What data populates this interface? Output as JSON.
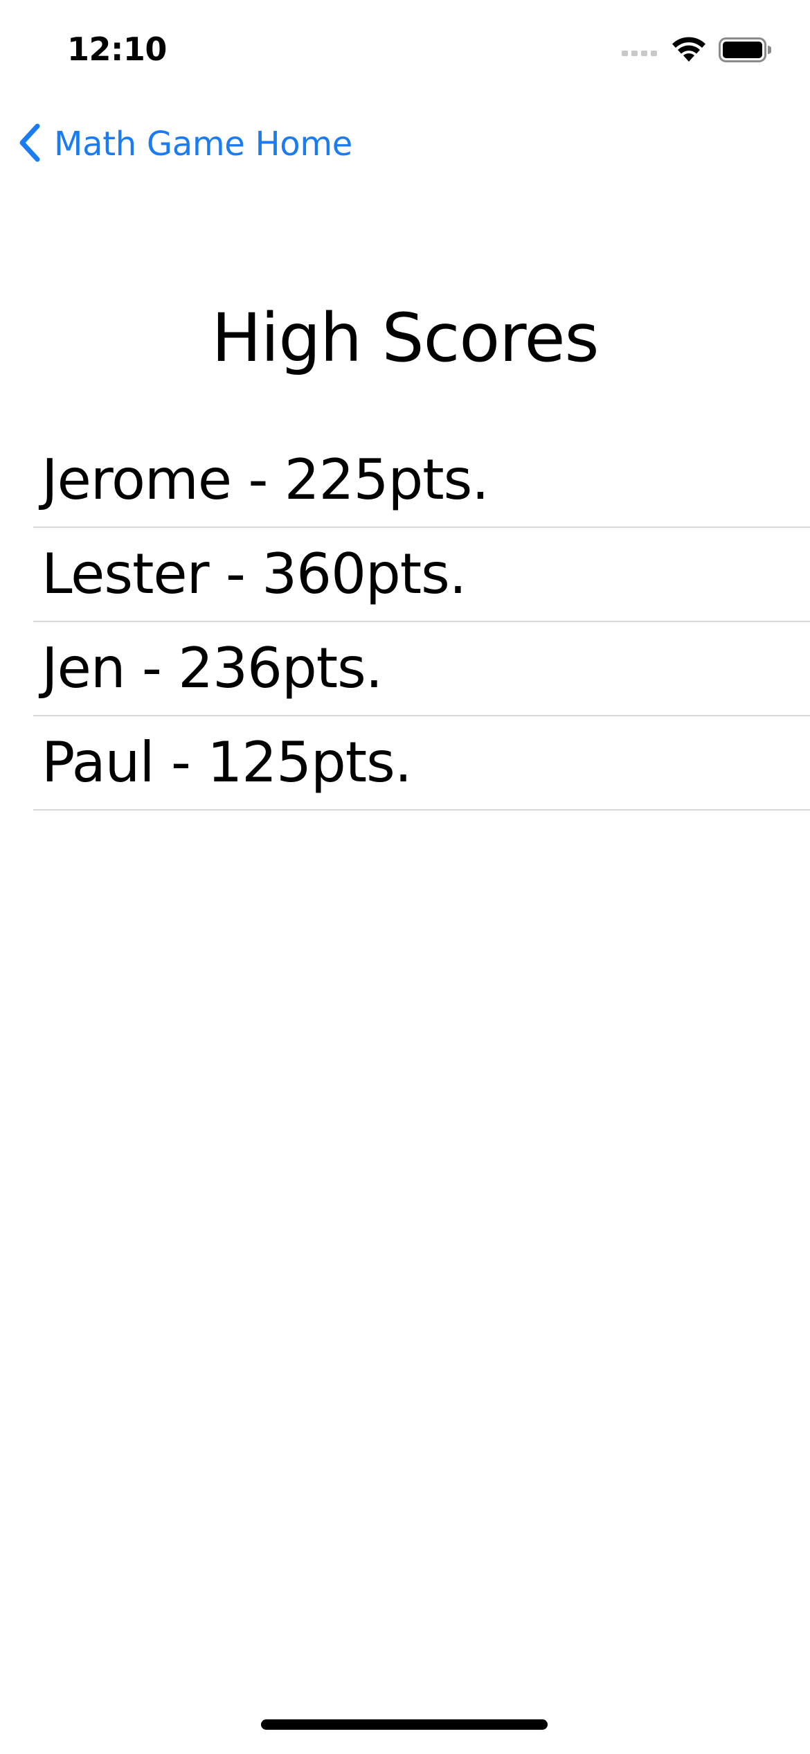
{
  "status_bar": {
    "time": "12:10",
    "icons": [
      "cellular-signal-icon",
      "wifi-icon",
      "battery-icon"
    ]
  },
  "nav": {
    "back_label": "Math Game Home",
    "back_icon": "chevron-left-icon",
    "accent_color": "#1a7bf2"
  },
  "page": {
    "title": "High Scores"
  },
  "scores": [
    {
      "text": "Jerome - 225pts."
    },
    {
      "text": "Lester - 360pts."
    },
    {
      "text": "Jen - 236pts."
    },
    {
      "text": "Paul - 125pts."
    }
  ]
}
